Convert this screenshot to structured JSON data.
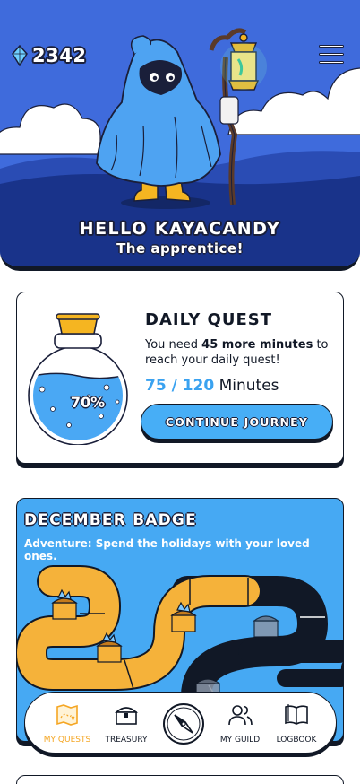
{
  "header": {
    "gem_count": "2342",
    "icons": {
      "currency": "gem-icon",
      "menu": "hamburger-menu-icon"
    },
    "greeting": "HELLO KAYACANDY",
    "rank": "The apprentice!"
  },
  "daily_quest": {
    "title": "DAILY QUEST",
    "desc_prefix": "You need ",
    "desc_bold": "45 more minutes",
    "desc_suffix": " to reach your daily quest!",
    "progress_numbers": "75 / 120",
    "progress_unit": "Minutes",
    "progress_fraction": 0.7,
    "percent_label": "70%",
    "button_label": "CONTINUE JOURNEY"
  },
  "badge": {
    "title": "DECEMBER BADGE",
    "subtitle": "Adventure: Spend the holidays with your loved ones."
  },
  "bottom_nav": {
    "items": [
      {
        "label": "MY QUESTS",
        "icon": "treasure-map-icon",
        "active": true
      },
      {
        "label": "TREASURY",
        "icon": "chest-icon",
        "active": false
      },
      {
        "label": "",
        "icon": "compass-icon",
        "active": false
      },
      {
        "label": "MY GUILD",
        "icon": "guild-people-icon",
        "active": false
      },
      {
        "label": "LOGBOOK",
        "icon": "book-icon",
        "active": false
      }
    ]
  },
  "colors": {
    "accent_blue": "#47aef6",
    "active_orange": "#f5a623",
    "outline": "#111826",
    "hero_sky": "#3f6bdc",
    "hero_hills": "#19338a"
  }
}
